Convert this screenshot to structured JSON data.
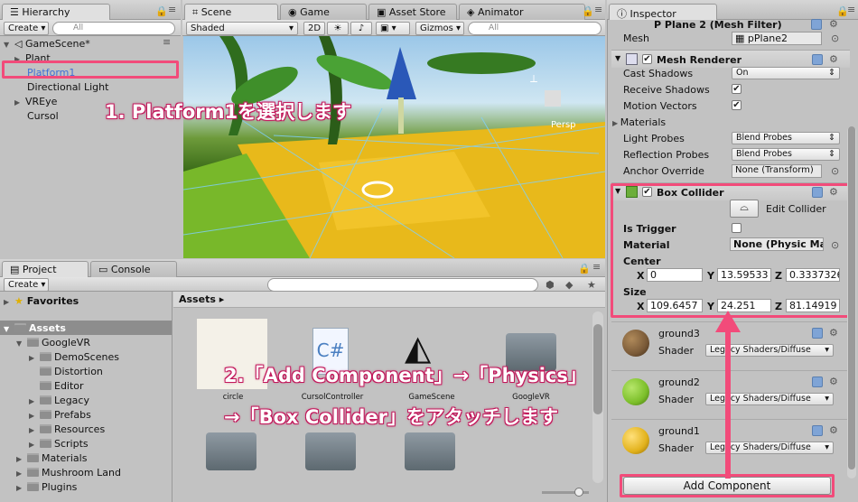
{
  "hierarchy": {
    "tab": "Hierarchy",
    "create": "Create",
    "search_placeholder": "All",
    "scene": "GameScene*",
    "items": [
      "Plant",
      "Platform1",
      "Directional Light",
      "VREye",
      "Cursol"
    ]
  },
  "scene": {
    "tabs": [
      "Scene",
      "Game",
      "Asset Store",
      "Animator"
    ],
    "shading": "Shaded",
    "mode_2d": "2D",
    "gizmos": "Gizmos",
    "search_placeholder": "All",
    "persp": "Persp"
  },
  "project": {
    "tabs": [
      "Project",
      "Console"
    ],
    "create": "Create",
    "favorites": "Favorites",
    "assets": "Assets",
    "breadcrumb": "Assets",
    "tree": [
      "GoogleVR",
      "DemoScenes",
      "Distortion",
      "Editor",
      "Legacy",
      "Prefabs",
      "Resources",
      "Scripts",
      "Materials",
      "Mushroom Land",
      "Plugins"
    ],
    "files": [
      "circle",
      "CursolController",
      "GameScene",
      "GoogleVR"
    ]
  },
  "inspector": {
    "tab": "Inspector",
    "mesh_filter": {
      "title": "P Plane 2 (Mesh Filter)",
      "mesh_label": "Mesh",
      "mesh_value": "pPlane2"
    },
    "mesh_renderer": {
      "title": "Mesh Renderer",
      "rows": [
        {
          "label": "Cast Shadows",
          "value": "On"
        },
        {
          "label": "Receive Shadows",
          "value": "✔"
        },
        {
          "label": "Motion Vectors",
          "value": "✔"
        },
        {
          "label": "Materials",
          "value": ""
        },
        {
          "label": "Light Probes",
          "value": "Blend Probes"
        },
        {
          "label": "Reflection Probes",
          "value": "Blend Probes"
        },
        {
          "label": "Anchor Override",
          "value": "None (Transform)"
        }
      ]
    },
    "box_collider": {
      "title": "Box Collider",
      "edit": "Edit Collider",
      "is_trigger": "Is Trigger",
      "material_label": "Material",
      "material_value": "None (Physic Mate",
      "center_label": "Center",
      "center": {
        "x": "0",
        "y": "13.59533",
        "z": "0.3337326"
      },
      "size_label": "Size",
      "size": {
        "x": "109.6457",
        "y": "24.251",
        "z": "81.14919"
      }
    },
    "materials": [
      {
        "name": "ground3",
        "shader": "Legacy Shaders/Diffuse",
        "color": "#7a5a38"
      },
      {
        "name": "ground2",
        "shader": "Legacy Shaders/Diffuse",
        "color": "#7cbf2a"
      },
      {
        "name": "ground1",
        "shader": "Legacy Shaders/Diffuse",
        "color": "#e2b21c"
      }
    ],
    "shader_label": "Shader",
    "add_component": "Add Component"
  },
  "annotations": {
    "step1": "1. Platform1を選択します",
    "step2a": "2.「Add Component」→「Physics」",
    "step2b": "→「Box Collider」をアタッチします",
    "accent": "#f24b7a"
  }
}
